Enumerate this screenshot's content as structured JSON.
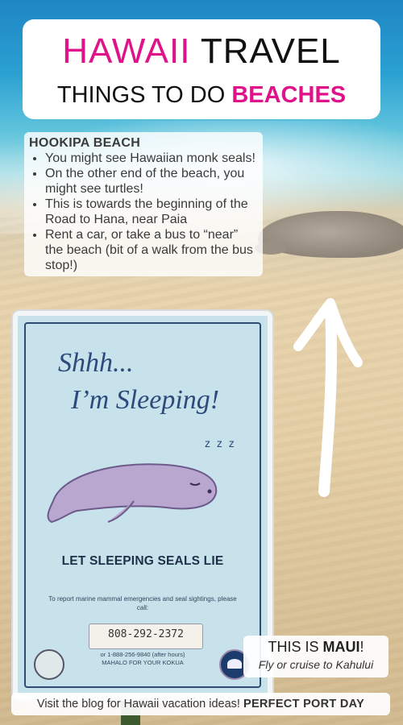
{
  "header": {
    "title_word1": "HAWAII",
    "title_word2": "TRAVEL",
    "subtitle_plain": "THINGS TO DO",
    "subtitle_highlight": "BEACHES"
  },
  "info": {
    "heading": "HOOKIPA BEACH",
    "items": [
      "You might see Hawaiian monk seals!",
      "On the other end of the beach, you might see turtles!",
      "This is towards the beginning of the Road to Hana, near Paia",
      "Rent a car, or take a bus to “near” the beach (bit of a walk from the bus stop!)"
    ]
  },
  "sign": {
    "line1": "Shhh...",
    "line2": "I’m Sleeping!",
    "zzz": "z z z",
    "let_sleeping": "LET SLEEPING SEALS LIE",
    "report": "To report marine mammal emergencies and seal sightings, please call:",
    "phone": "808-292-2372",
    "hours_line": "or 1-888-256-9840 (after hours)",
    "mahalo": "MAHALO FOR YOUR KOKUA"
  },
  "location": {
    "prefix": "THIS IS",
    "place": "MAUI",
    "suffix": "!",
    "subline": "Fly or cruise to Kahului"
  },
  "footer": {
    "text": "Visit the blog for Hawaii vacation ideas!",
    "brand": "PERFECT PORT DAY"
  },
  "colors": {
    "accent": "#e0128a",
    "sign_ink": "#2c4b7c",
    "sign_bg": "#c7e2ea"
  },
  "icons": [
    "arrow-up-icon",
    "seal-icon",
    "nps-logo-icon",
    "noaa-logo-icon"
  ]
}
